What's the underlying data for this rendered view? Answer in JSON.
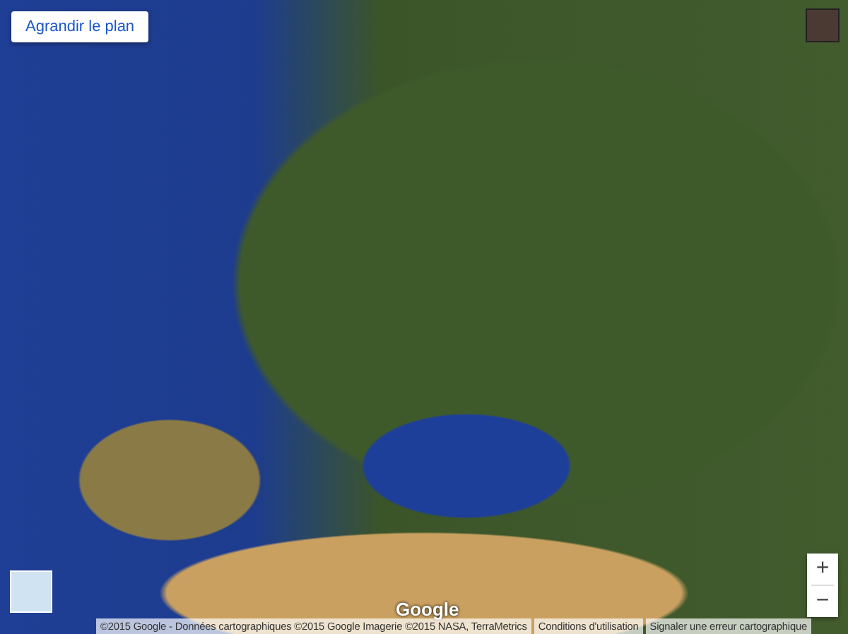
{
  "expand_button": {
    "label": "Agrandir le plan"
  },
  "zoom_controls": {
    "zoom_in": "+",
    "zoom_out": "−"
  },
  "logo": "Google",
  "attribution": {
    "copyright": "©2015 Google - Données cartographiques ©2015 Google Imagerie ©2015 NASA, TerraMetrics",
    "terms": "Conditions d'utilisation",
    "report": "Signaler une erreur cartographique"
  }
}
